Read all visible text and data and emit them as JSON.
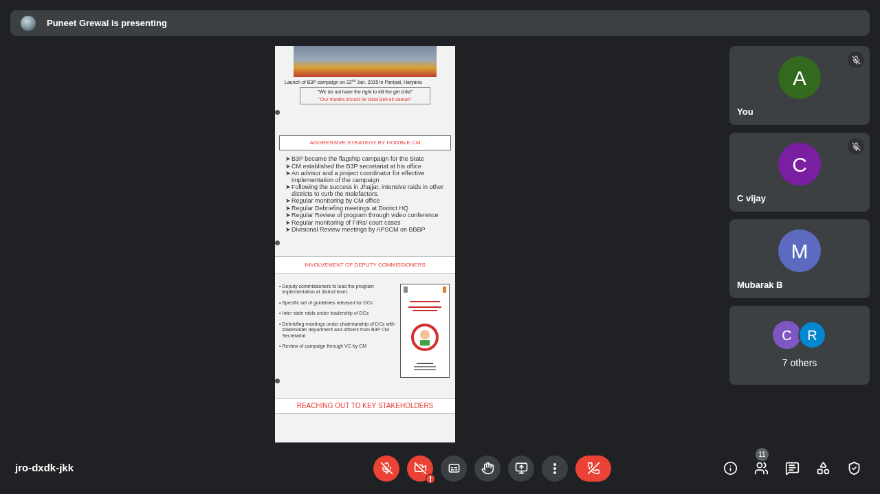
{
  "banner": {
    "text": "Puneet Grewal is presenting"
  },
  "slide": {
    "caption": "Launch of B3P campaign on 22$^{nd}$ Jan. 2015 in Panipat, Haryana",
    "quotes": [
      {
        "text": "\"We do not have the right to kill the girl child\"",
        "emphasis": false
      },
      {
        "text": "\"Our mantra should be Beta Beti ek saman\"",
        "emphasis": true
      }
    ],
    "strategy": {
      "title": "AGGRESSIVE STRATEGY BY HON'BLE CM",
      "marker": "➤",
      "items": [
        "B3P became the flagship campaign for the State",
        "CM established the B3P secretariat at his office",
        "An advisor and a project coordinator for effective implementation of the campaign",
        "Following the success in Jhajjar, intensive raids in other districts to curb the malefactors.",
        "Regular monitoring by CM office",
        "Regular Debriefing meetings at District HQ",
        "Regular Review of program through video conference",
        "Regular monitoring of  FIRs/ court cases",
        "Divisional Review meetings by APSCM on BBBP"
      ]
    },
    "involvement": {
      "title": "INVOLVEMENT OF DEPUTY COMMISSIONERS",
      "marker": "•",
      "items": [
        "Deputy commissioners to lead the program implementation at district level.",
        "Specific set of guidelines released for DCs",
        "Inter state raids under leadership of DCs",
        "Debriefing meetings under chairmanship of DCs with stakeholder department and officers from B3P CM Secretariat",
        "Review of campaign through VC by CM"
      ]
    },
    "stakeholders": {
      "title": "REACHING OUT TO KEY STAKEHOLDERS"
    }
  },
  "participants": [
    {
      "initial": "A",
      "name": "You",
      "color": "#33691e",
      "muted": true
    },
    {
      "initial": "C",
      "name": "C vijay",
      "color": "#7b1fa2",
      "muted": true
    },
    {
      "initial": "M",
      "name": "Mubarak B",
      "color": "#5c6bc0",
      "muted": false
    }
  ],
  "others": {
    "avatars": [
      {
        "initial": "C",
        "color": "#7e57c2"
      },
      {
        "initial": "R",
        "color": "#0288d1"
      }
    ],
    "label": "7 others"
  },
  "meeting_code": "jro-dxdk-jkk",
  "controls": [
    {
      "kind": "mic",
      "on": false
    },
    {
      "kind": "camera",
      "on": false
    },
    {
      "kind": "captions",
      "on": false
    },
    {
      "kind": "hand",
      "on": false
    },
    {
      "kind": "present",
      "on": false
    },
    {
      "kind": "more",
      "on": false
    },
    {
      "kind": "end"
    }
  ],
  "side_buttons": [
    {
      "kind": "info"
    },
    {
      "kind": "people",
      "badge": "11"
    },
    {
      "kind": "chat"
    },
    {
      "kind": "activities"
    },
    {
      "kind": "safety"
    }
  ]
}
